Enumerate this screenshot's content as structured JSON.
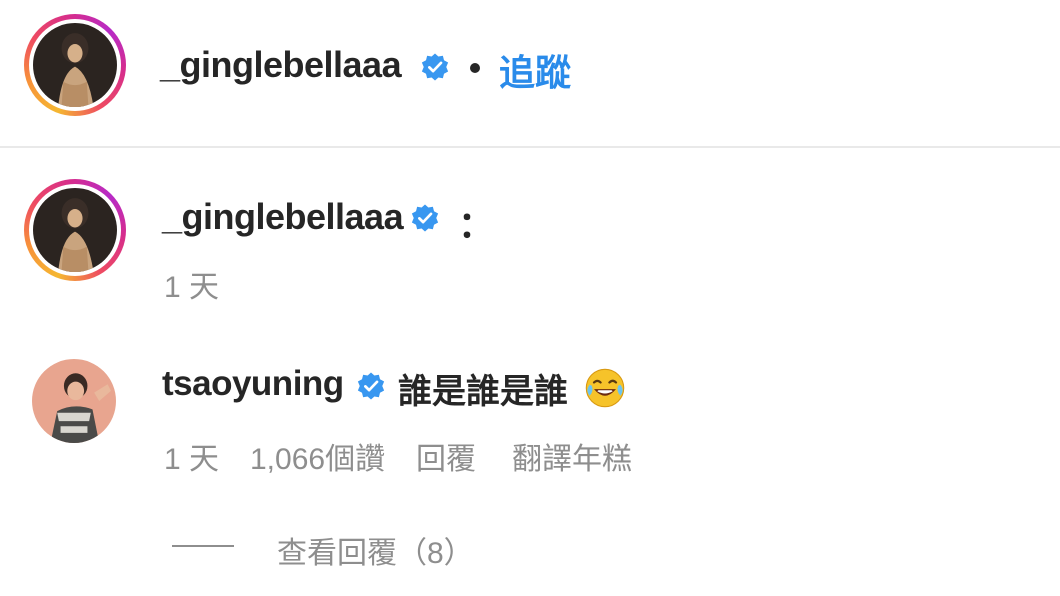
{
  "header": {
    "username": "_ginglebellaaa",
    "separator": "•",
    "follow_label": "追蹤"
  },
  "caption": {
    "username": "_ginglebellaaa",
    "text": "：",
    "time": "1 天"
  },
  "comment": {
    "username": "tsaoyuning",
    "text": "誰是誰是誰",
    "emoji": "face-with-tears-of-joy-emoji",
    "time": "1 天",
    "likes": "1,066個讚",
    "reply_label": "回覆",
    "translate_label": "翻譯年糕"
  },
  "replies": {
    "view_label": "查看回覆（8）"
  },
  "colors": {
    "link_blue": "#2a8bea",
    "verified_blue": "#3897f0",
    "text_primary": "#262626",
    "text_secondary": "#8e8e8e"
  }
}
